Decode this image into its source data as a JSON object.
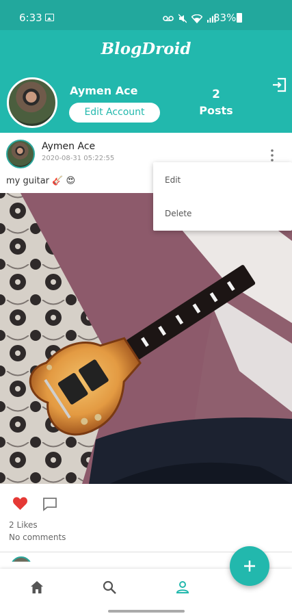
{
  "status_bar": {
    "time": "6:33",
    "battery": "83%",
    "icons": [
      "image-icon",
      "voicemail-icon",
      "mute-icon",
      "wifi-icon",
      "signal-icon",
      "battery-icon"
    ]
  },
  "app_bar": {
    "title": "BlogDroid"
  },
  "profile": {
    "name": "Aymen Ace",
    "edit_button": "Edit Account",
    "posts_count": "2",
    "posts_label": "Posts"
  },
  "post": {
    "author": "Aymen Ace",
    "date": "2020-08-31 05:22:55",
    "caption": "my guitar 🎸 😍",
    "likes": "2 Likes",
    "comments": "No comments",
    "liked": true
  },
  "post_menu": {
    "items": [
      {
        "label": "Edit"
      },
      {
        "label": "Delete"
      }
    ]
  },
  "bottom_nav": {
    "items": [
      "home-icon",
      "search-icon",
      "profile-icon"
    ],
    "active": "profile-icon"
  },
  "colors": {
    "primary": "#22b8ad",
    "status_bar": "#22a89d",
    "like": "#e53935"
  }
}
